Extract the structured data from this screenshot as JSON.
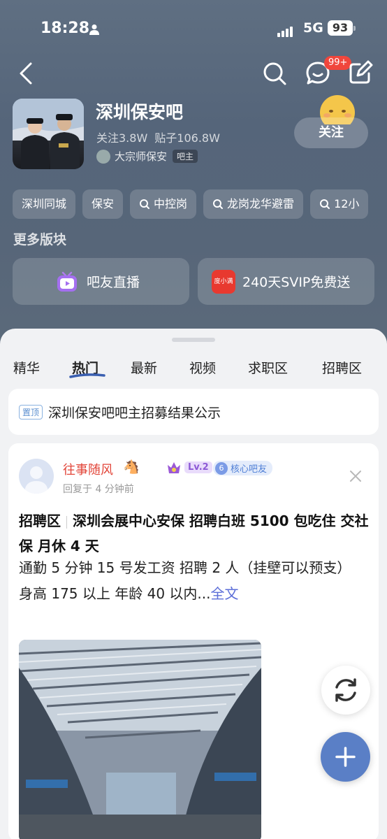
{
  "status_bar": {
    "time": "18:28",
    "network": "5G",
    "battery": "93"
  },
  "nav": {
    "badge": "99+"
  },
  "forum": {
    "name": "深圳保安吧",
    "followers": "关注3.8W",
    "posts": "贴子106.8W",
    "owner_name": "大宗师保安",
    "owner_tag": "吧主",
    "follow_label": "关注"
  },
  "tags": [
    "深圳同城",
    "保安",
    "中控岗",
    "龙岗龙华避雷",
    "12小"
  ],
  "more_blocks": {
    "title": "更多版块",
    "items": [
      {
        "label": "吧友直播",
        "icon": "live-tv-icon"
      },
      {
        "label": "240天SVIP免费送",
        "icon": "svip-gift-icon",
        "icon_text": "度小满"
      }
    ]
  },
  "tabs": [
    {
      "label": "精华",
      "active": false
    },
    {
      "label": "热门",
      "active": true
    },
    {
      "label": "最新",
      "active": false
    },
    {
      "label": "视频",
      "active": false
    },
    {
      "label": "求职区",
      "active": false
    },
    {
      "label": "招聘区",
      "active": false
    }
  ],
  "pinned": {
    "tag": "置顶",
    "text": "深圳保安吧吧主招募结果公示"
  },
  "post": {
    "user": "往事随风",
    "emojis": "🐴😹",
    "level": "Lv.2",
    "core_num": "6",
    "core_label": "核心吧友",
    "reply_time": "回复于 4 分钟前",
    "section": "招聘区",
    "title": "深圳会展中心安保 招聘白班 5100 包吃住 交社保 月休 4 天",
    "body_1": "通勤 5 分钟 15 号发工资 招聘 2 人（挂壁可以预支）",
    "body_2": "身高 175 以上 年龄 40 以内...",
    "more": "全文"
  },
  "colors": {
    "accent": "#5a7fc6",
    "username": "#e2463a",
    "badge": "#f0463c"
  }
}
